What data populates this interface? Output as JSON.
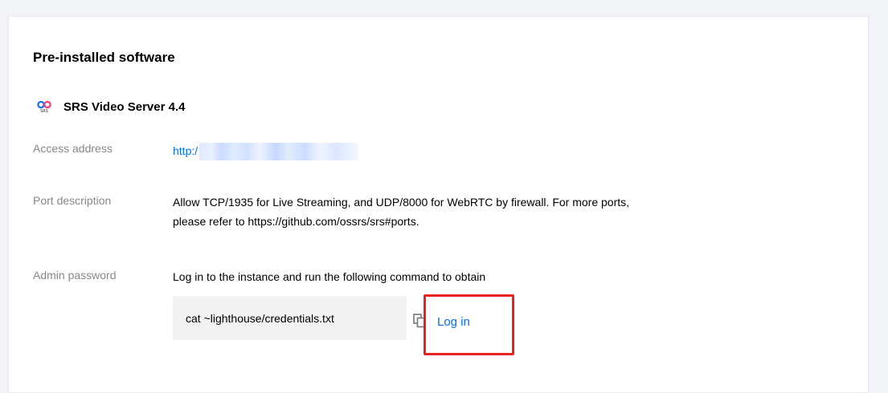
{
  "section": {
    "title": "Pre-installed software"
  },
  "app": {
    "icon": "srs-logo-icon",
    "logo_text": "SRS",
    "name": "SRS Video Server 4.4"
  },
  "fields": {
    "access_address": {
      "label": "Access address",
      "value": "http:/"
    },
    "port_description": {
      "label": "Port description",
      "line1": "Allow TCP/1935 for Live Streaming, and UDP/8000 for WebRTC by firewall. For more ports,",
      "line2": "please refer to https://github.com/ossrs/srs#ports."
    },
    "admin_password": {
      "label": "Admin password",
      "value": "Log in to the instance and run the following command to obtain",
      "command": "cat ~lighthouse/credentials.txt",
      "copy_icon": "copy-icon",
      "login_label": "Log in"
    }
  },
  "colors": {
    "link": "#006eff",
    "highlight": "#e8221f",
    "label": "#888888",
    "command_bg": "#f2f2f2"
  }
}
